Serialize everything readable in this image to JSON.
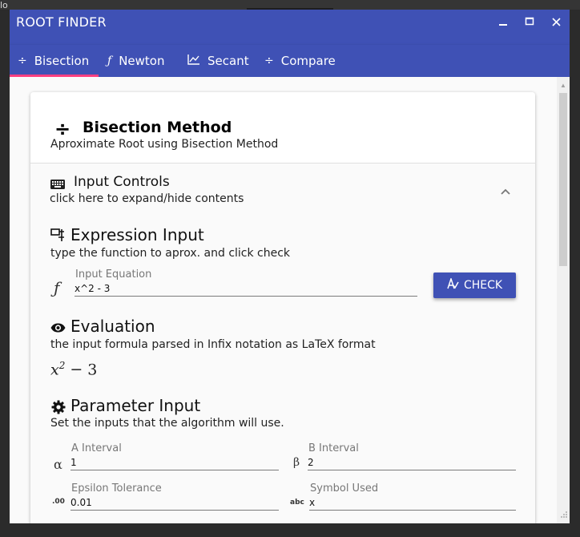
{
  "app": {
    "title": "ROOT FINDER",
    "window_buttons": [
      "minimize",
      "maximize",
      "close"
    ],
    "accent_color": "#3f51b5",
    "tab_indicator_color": "#ff4081"
  },
  "background": {
    "fragment": "lo"
  },
  "tabs": [
    {
      "label": "Bisection",
      "icon": "divide-icon",
      "selected": true
    },
    {
      "label": "Newton",
      "icon": "function-icon",
      "selected": false
    },
    {
      "label": "Secant",
      "icon": "line-chart-icon",
      "selected": false
    },
    {
      "label": "Compare",
      "icon": "divide-icon",
      "selected": false
    }
  ],
  "card": {
    "title": "Bisection Method",
    "subtitle": "Aproximate Root using Bisection Method"
  },
  "input_controls": {
    "title": "Input Controls",
    "subtitle": "click here to expand/hide contents",
    "expanded": true
  },
  "expression": {
    "title": "Expression Input",
    "subtitle": "type the function to aprox. and click check",
    "field_label": "Input Equation",
    "field_value": "x^2 - 3",
    "check_label": "CHECK"
  },
  "evaluation": {
    "title": "Evaluation",
    "subtitle": "the input formula parsed in Infix notation as LaTeX format",
    "latex_var": "x",
    "latex_exp": "2",
    "latex_op": "−",
    "latex_num": "3"
  },
  "parameters": {
    "title": "Parameter Input",
    "subtitle": "Set the inputs that the algorithm will use.",
    "a_label": "A Interval",
    "a_value": "1",
    "b_label": "B Interval",
    "b_value": "2",
    "eps_label": "Epsilon Tolerance",
    "eps_value": "0.01",
    "sym_label": "Symbol Used",
    "sym_value": "x",
    "a_prefix": "α",
    "b_prefix": "β",
    "eps_prefix": ".00",
    "sym_prefix": "abc"
  }
}
